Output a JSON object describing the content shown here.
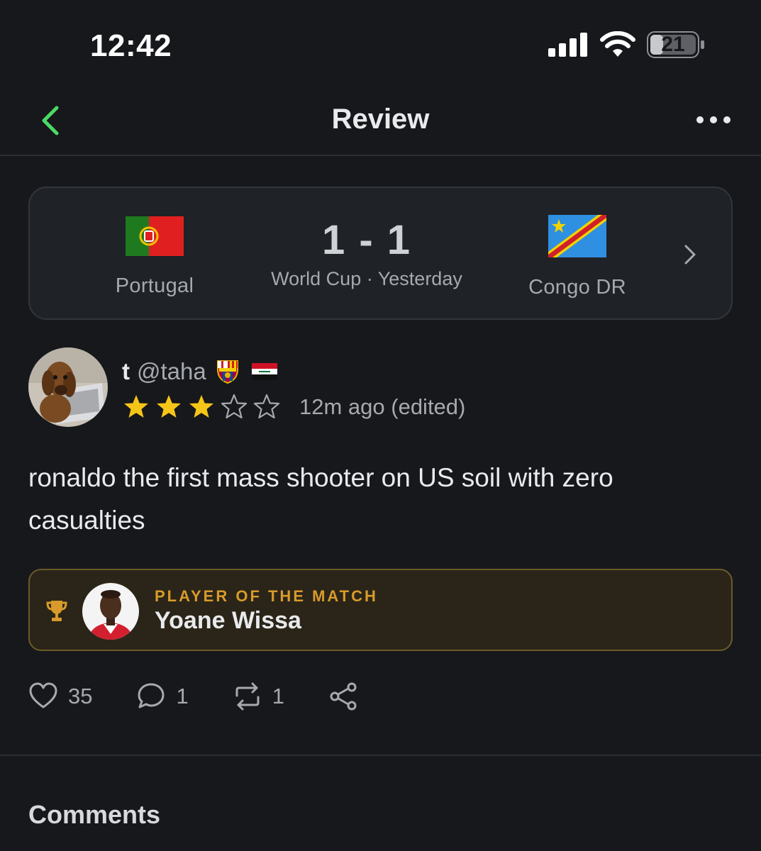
{
  "status_bar": {
    "time": "12:42",
    "battery_level": "21",
    "icons": [
      "cellular-signal-icon",
      "wifi-icon",
      "battery-icon"
    ]
  },
  "nav": {
    "title": "Review",
    "back_icon": "chevron-left-icon",
    "more_icon": "ellipsis-icon",
    "accent_color": "#4cd964"
  },
  "match": {
    "home_team": "Portugal",
    "away_team": "Congo DR",
    "score": "1 - 1",
    "competition": "World Cup",
    "separator": "·",
    "date": "Yesterday",
    "home_flag_icon": "portugal-flag-icon",
    "away_flag_icon": "congo-dr-flag-icon"
  },
  "review": {
    "author_name": "t",
    "author_handle": "@taha",
    "badges": [
      "fc-barcelona-crest-icon",
      "iraq-flag-icon"
    ],
    "rating": 3,
    "rating_max": 5,
    "timestamp": "12m ago (edited)",
    "body": "ronaldo the first mass shooter on US soil with zero casualties"
  },
  "player_of_the_match": {
    "label": "PLAYER OF THE MATCH",
    "player_name": "Yoane Wissa",
    "accent_color": "#d99a2b"
  },
  "actions": {
    "likes": "35",
    "comments": "1",
    "reposts": "1"
  },
  "comments": {
    "heading": "Comments"
  }
}
